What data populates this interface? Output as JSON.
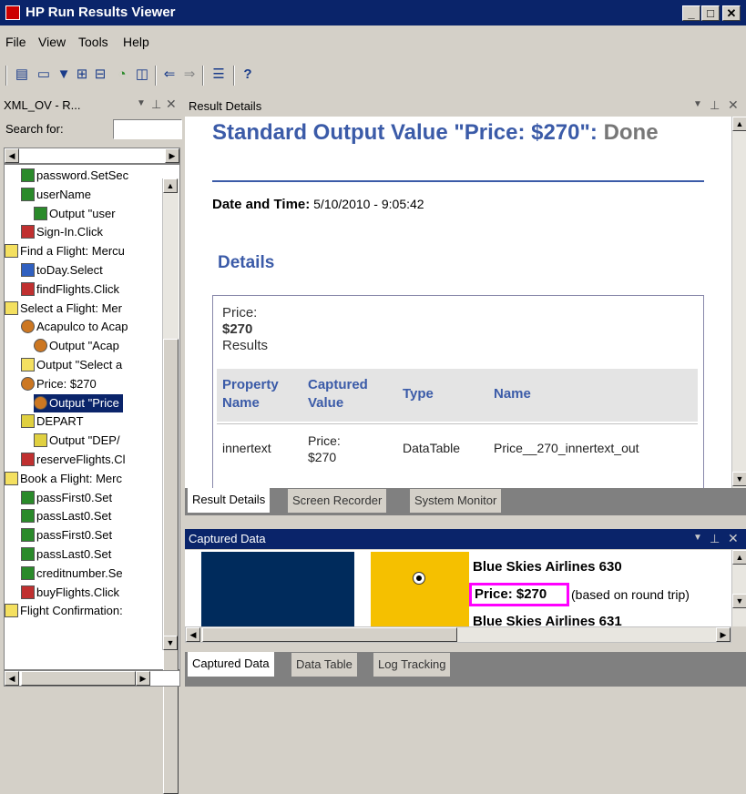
{
  "window": {
    "title": "HP Run Results Viewer"
  },
  "menu": [
    "File",
    "View",
    "Tools",
    "Help"
  ],
  "left_panel": {
    "header": "XML_OV - R...",
    "search_label": "Search for:",
    "search_value": "",
    "tree": [
      {
        "label": "password.SetSec",
        "icon": "abc-icon",
        "indent": 1
      },
      {
        "label": "userName",
        "icon": "abc-icon",
        "indent": 1
      },
      {
        "label": "Output \"user",
        "icon": "abc-icon",
        "indent": 2
      },
      {
        "label": "Sign-In.Click",
        "icon": "button-icon",
        "indent": 1
      },
      {
        "label": "Find a Flight: Mercu",
        "icon": "page-icon",
        "indent": 0
      },
      {
        "label": "toDay.Select",
        "icon": "list-icon",
        "indent": 1
      },
      {
        "label": "findFlights.Click",
        "icon": "button-icon",
        "indent": 1
      },
      {
        "label": "Select a Flight: Mer",
        "icon": "page-icon",
        "indent": 0
      },
      {
        "label": "Acapulco to Acap",
        "icon": "flight-icon",
        "indent": 1
      },
      {
        "label": "Output \"Acap",
        "icon": "flight-icon",
        "indent": 2
      },
      {
        "label": "Output \"Select a",
        "icon": "page-icon",
        "indent": 1
      },
      {
        "label": "Price: $270",
        "icon": "flight-icon",
        "indent": 1
      },
      {
        "label": "Output \"Price",
        "icon": "flight-icon",
        "indent": 2,
        "selected": true
      },
      {
        "label": "DEPART",
        "icon": "grid-icon",
        "indent": 1
      },
      {
        "label": "Output \"DEP/",
        "icon": "grid-icon",
        "indent": 2
      },
      {
        "label": "reserveFlights.Cl",
        "icon": "button-icon",
        "indent": 1
      },
      {
        "label": "Book a Flight: Merc",
        "icon": "page-icon",
        "indent": 0
      },
      {
        "label": "passFirst0.Set",
        "icon": "abc-icon",
        "indent": 1
      },
      {
        "label": "passLast0.Set",
        "icon": "abc-icon",
        "indent": 1
      },
      {
        "label": "passFirst0.Set",
        "icon": "abc-icon",
        "indent": 1
      },
      {
        "label": "passLast0.Set",
        "icon": "abc-icon",
        "indent": 1
      },
      {
        "label": "creditnumber.Se",
        "icon": "abc-icon",
        "indent": 1
      },
      {
        "label": "buyFlights.Click",
        "icon": "button-icon",
        "indent": 1
      },
      {
        "label": "Flight Confirmation:",
        "icon": "page-icon",
        "indent": 0
      }
    ]
  },
  "result_details": {
    "header": "Result Details",
    "title_main": "Standard Output Value \"Price: $270\"",
    "title_sep": ": ",
    "title_status": "Done",
    "date_label": "Date and Time:",
    "date_value": " 5/10/2010 - 9:05:42",
    "details_heading": "Details",
    "box_title_1": "Price:",
    "box_title_2": "$270",
    "box_title_3": "Results",
    "columns": [
      "Property Name",
      "Captured Value",
      "Type",
      "Name"
    ],
    "row": [
      "innertext",
      "Price: $270",
      "DataTable",
      "Price__270_innertext_out"
    ]
  },
  "tabs_top": [
    "Result Details",
    "Screen Recorder",
    "System Monitor"
  ],
  "captured": {
    "header": "Captured Data",
    "airline1": "Blue Skies Airlines 630",
    "price": "Price: $270",
    "round_trip": "(based on round trip)",
    "airline2": "Blue Skies Airlines 631"
  },
  "tabs_bottom": [
    "Captured Data",
    "Data Table",
    "Log Tracking"
  ]
}
